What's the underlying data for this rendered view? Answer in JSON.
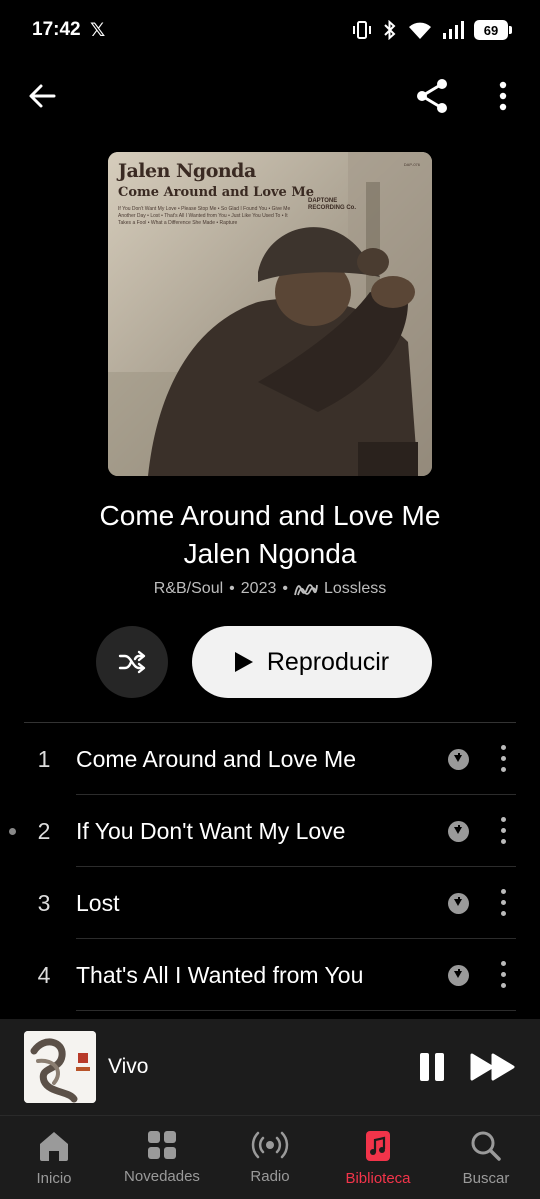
{
  "status_bar": {
    "time": "17:42",
    "x_logo": "𝕏",
    "battery": "69"
  },
  "album": {
    "title": "Come Around and Love Me",
    "artist": "Jalen Ngonda",
    "genre": "R&B/Soul",
    "year": "2023",
    "quality": "Lossless",
    "separator": "•"
  },
  "cover": {
    "artist_text": "Jalen Ngonda",
    "title_text": "Come Around and Love Me",
    "tracklist_text": "If You Don't Want My Love • Please Stop Me • So Glad I Found You • Give Me Another Day • Lost • That's All I Wanted from You • Just Like You Used To • It Takes a Fool • What a Difference She Made • Rapture",
    "label_text": "DAPTONE RECORDING Co.",
    "catalog_text": "DAP-076"
  },
  "buttons": {
    "play_label": "Reproducir"
  },
  "tracks": [
    {
      "number": "1",
      "title": "Come Around and Love Me"
    },
    {
      "number": "2",
      "title": "If You Don't Want My Love"
    },
    {
      "number": "3",
      "title": "Lost"
    },
    {
      "number": "4",
      "title": "That's All I Wanted from You"
    }
  ],
  "mini_player": {
    "title": "Vivo"
  },
  "tabs": [
    {
      "label": "Inicio",
      "icon": "home-icon",
      "active": false
    },
    {
      "label": "Novedades",
      "icon": "grid-icon",
      "active": false
    },
    {
      "label": "Radio",
      "icon": "radio-icon",
      "active": false
    },
    {
      "label": "Biblioteca",
      "icon": "music-library-icon",
      "active": true
    },
    {
      "label": "Buscar",
      "icon": "search-icon",
      "active": false
    }
  ],
  "colors": {
    "accent": "#f2344a",
    "background": "#000000",
    "mini_player_bg": "#1c1c1c"
  }
}
